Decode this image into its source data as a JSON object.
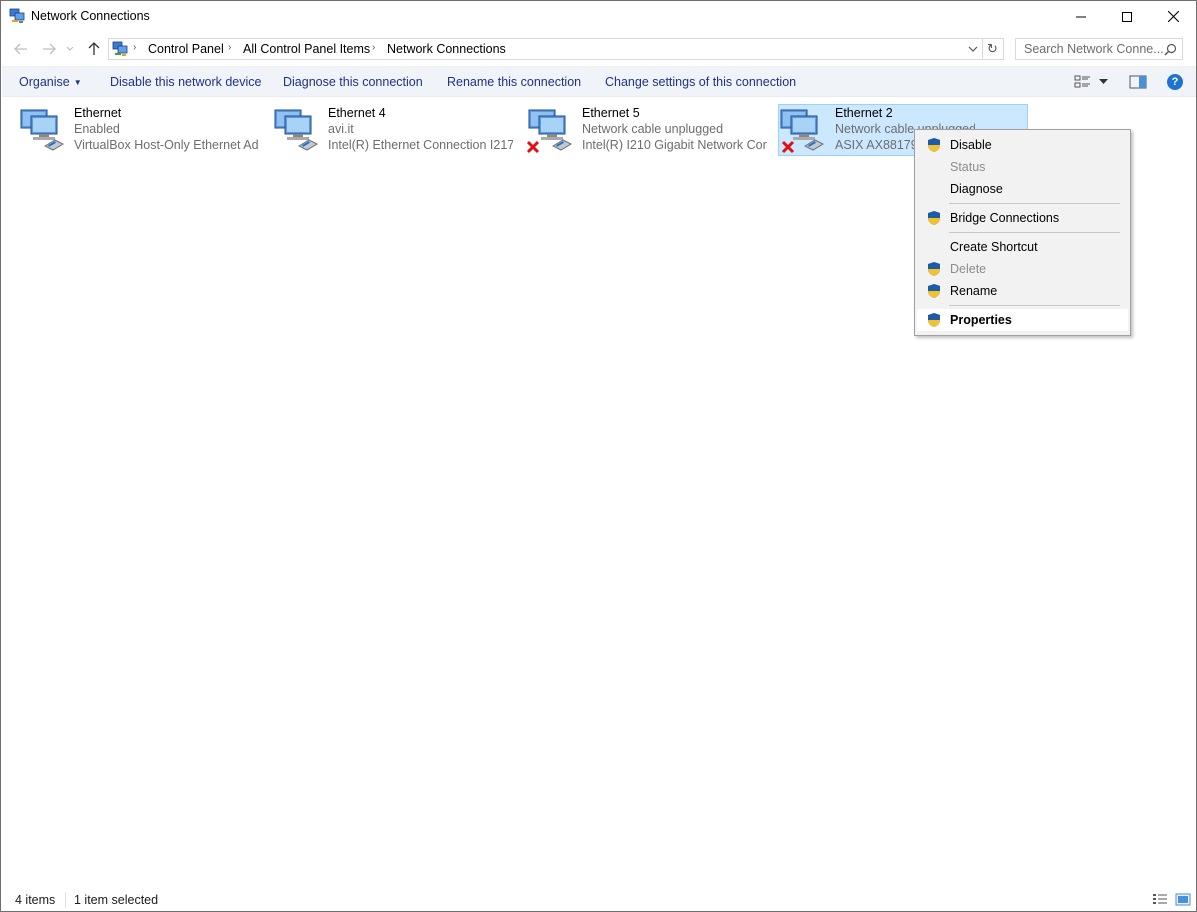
{
  "window": {
    "title": "Network Connections",
    "icon": "network-connections-icon"
  },
  "address": {
    "crumbs": [
      "Control Panel",
      "All Control Panel Items",
      "Network Connections"
    ],
    "search_placeholder": "Search Network Conne..."
  },
  "toolbar": {
    "organise": "Organise",
    "disable": "Disable this network device",
    "diagnose": "Diagnose this connection",
    "rename": "Rename this connection",
    "change_settings": "Change settings of this connection",
    "help": "?"
  },
  "items": [
    {
      "name": "Ethernet",
      "status": "Enabled",
      "device": "VirtualBox Host-Only Ethernet Ad...",
      "disconnected": false,
      "selected": false
    },
    {
      "name": "Ethernet 4",
      "status": "avi.it",
      "device": "Intel(R) Ethernet Connection I217...",
      "disconnected": false,
      "selected": false
    },
    {
      "name": "Ethernet 5",
      "status": "Network cable unplugged",
      "device": "Intel(R) I210 Gigabit Network Con...",
      "disconnected": true,
      "selected": false
    },
    {
      "name": "Ethernet 2",
      "status": "Network cable unplugged",
      "device": "ASIX AX88179 U",
      "disconnected": true,
      "selected": true
    }
  ],
  "context_menu": {
    "items": [
      {
        "label": "Disable",
        "shield": true,
        "disabled": false
      },
      {
        "label": "Status",
        "shield": false,
        "disabled": true
      },
      {
        "label": "Diagnose",
        "shield": false,
        "disabled": false
      },
      {
        "label": "Bridge Connections",
        "shield": true,
        "disabled": false
      },
      {
        "label": "Create Shortcut",
        "shield": false,
        "disabled": false
      },
      {
        "label": "Delete",
        "shield": true,
        "disabled": true
      },
      {
        "label": "Rename",
        "shield": true,
        "disabled": false
      },
      {
        "label": "Properties",
        "shield": true,
        "disabled": false,
        "bold": true,
        "highlighted": true
      }
    ]
  },
  "status": {
    "count": "4 items",
    "selected": "1 item selected"
  },
  "colors": {
    "command_text": "#1e3287",
    "selection_bg": "#cce8ff",
    "selection_border": "#99d1ff",
    "help_blue": "#1e72d0"
  }
}
